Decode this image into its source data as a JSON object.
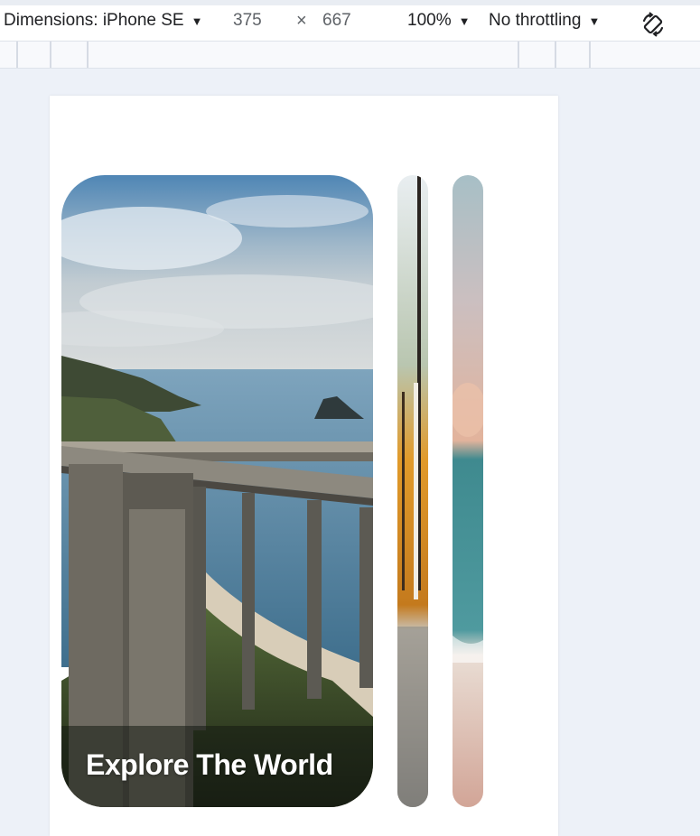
{
  "devtools": {
    "dimensions_label": "Dimensions: iPhone SE",
    "width": "375",
    "times": "×",
    "height": "667",
    "zoom": "100%",
    "throttling": "No throttling",
    "rotate_icon": "rotate-icon"
  },
  "carousel": {
    "cards": [
      {
        "title": "Explore The World",
        "image": "coastal-bridge-image"
      },
      {
        "image": "autumn-forest-image"
      },
      {
        "image": "beach-sunset-image"
      }
    ]
  },
  "colors": {
    "page_background": "#edf1f8",
    "toolbar_background": "#ffffff",
    "ruler_background": "#f8f9fc",
    "viewport_background": "#ffffff",
    "title_text": "#ffffff"
  }
}
